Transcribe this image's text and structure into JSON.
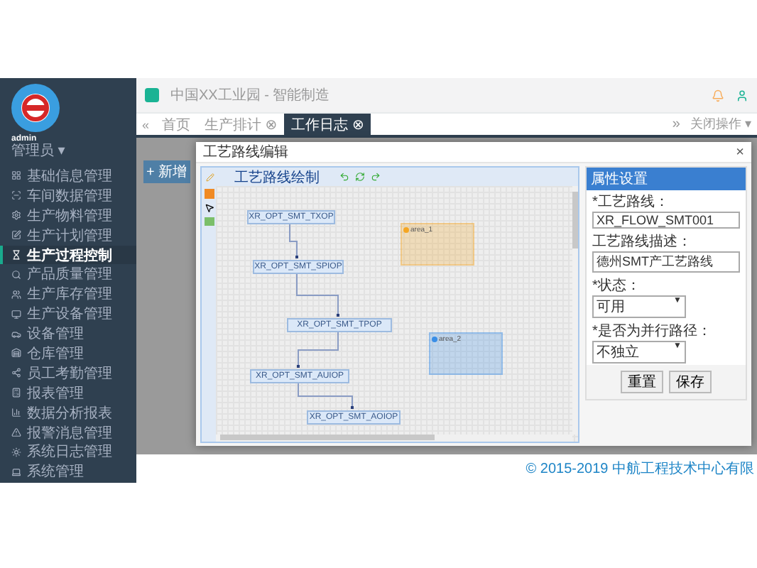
{
  "sidebar": {
    "user": "admin",
    "role": "管理员 ▾",
    "items": [
      {
        "label": "基础信息管理",
        "selected": false
      },
      {
        "label": "车间数据管理",
        "selected": false
      },
      {
        "label": "生产物料管理",
        "selected": false
      },
      {
        "label": "生产计划管理",
        "selected": false
      },
      {
        "label": "生产过程控制",
        "selected": true
      },
      {
        "label": "产品质量管理",
        "selected": false
      },
      {
        "label": "生产库存管理",
        "selected": false
      },
      {
        "label": "生产设备管理",
        "selected": false
      },
      {
        "label": "设备管理",
        "selected": false
      },
      {
        "label": "仓库管理",
        "selected": false
      },
      {
        "label": "员工考勤管理",
        "selected": false
      },
      {
        "label": "报表管理",
        "selected": false
      },
      {
        "label": "数据分析报表",
        "selected": false
      },
      {
        "label": "报警消息管理",
        "selected": false
      },
      {
        "label": "系统日志管理",
        "selected": false
      },
      {
        "label": "系统管理",
        "selected": false
      }
    ]
  },
  "header": {
    "breadcrumb": "中国XX工业园 - 智能制造"
  },
  "tabs": [
    {
      "label": "首页",
      "selected": false
    },
    {
      "label": "生产排计 ⊗",
      "selected": false
    },
    {
      "label": "工作日志 ⊗",
      "selected": true
    }
  ],
  "tab_nav": {
    "left": "«",
    "right": "»"
  },
  "close_menu": "关闭操作 ▾",
  "content": {
    "add_button": "+ 新增"
  },
  "modal": {
    "title": "工艺路线编辑",
    "close": "×",
    "toolbar_title": "工艺路线绘制",
    "nodes": [
      {
        "label": "XR_OPT_SMT_TXOP"
      },
      {
        "label": "XR_OPT_SMT_SPIOP"
      },
      {
        "label": "XR_OPT_SMT_TPOP"
      },
      {
        "label": "XR_OPT_SMT_AUIOP"
      },
      {
        "label": "XR_OPT_SMT_AOIOP"
      }
    ],
    "areas": [
      {
        "label": "area_1",
        "color": "#f5a623"
      },
      {
        "label": "area_2",
        "color": "#3a8ee6"
      }
    ],
    "properties": {
      "title": "属性设置",
      "fields": [
        {
          "label": "*工艺路线：",
          "value": "XR_FLOW_SMT001",
          "kind": "text"
        },
        {
          "label": "工艺路线描述：",
          "value": "德州SMT产工艺路线",
          "kind": "text"
        },
        {
          "label": "*状态：",
          "value": "可用",
          "kind": "select",
          "caret": "▼"
        },
        {
          "label": "*是否为并行路径：",
          "value": "不独立",
          "kind": "select",
          "caret": "▼"
        }
      ],
      "buttons": [
        "重置",
        "保存"
      ]
    }
  },
  "footer": "© 2015-2019 中航工程技术中心有限"
}
